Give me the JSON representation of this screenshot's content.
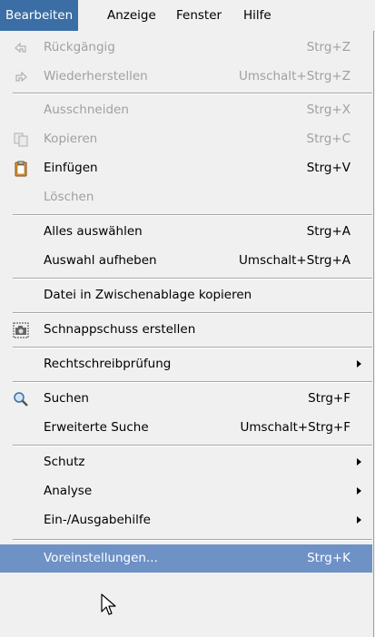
{
  "menubar": {
    "items": [
      "Bearbeiten",
      "Anzeige",
      "Fenster",
      "Hilfe"
    ],
    "active_index": 0
  },
  "menu": {
    "items": [
      {
        "label": "Rückgängig",
        "shortcut": "Strg+Z",
        "enabled": false,
        "icon": "undo-icon"
      },
      {
        "label": "Wiederherstellen",
        "shortcut": "Umschalt+Strg+Z",
        "enabled": false,
        "icon": "redo-icon"
      },
      {
        "label": "Ausschneiden",
        "shortcut": "Strg+X",
        "enabled": false
      },
      {
        "label": "Kopieren",
        "shortcut": "Strg+C",
        "enabled": false,
        "icon": "copy-icon"
      },
      {
        "label": "Einfügen",
        "shortcut": "Strg+V",
        "enabled": true,
        "icon": "paste-icon"
      },
      {
        "label": "Löschen",
        "shortcut": "",
        "enabled": false
      },
      {
        "label": "Alles auswählen",
        "shortcut": "Strg+A",
        "enabled": true
      },
      {
        "label": "Auswahl aufheben",
        "shortcut": "Umschalt+Strg+A",
        "enabled": true
      },
      {
        "label": "Datei in Zwischenablage kopieren",
        "shortcut": "",
        "enabled": true
      },
      {
        "label": "Schnappschuss erstellen",
        "shortcut": "",
        "enabled": true,
        "icon": "camera-icon"
      },
      {
        "label": "Rechtschreibprüfung",
        "shortcut": "",
        "enabled": true,
        "submenu": true
      },
      {
        "label": "Suchen",
        "shortcut": "Strg+F",
        "enabled": true,
        "icon": "search-icon"
      },
      {
        "label": "Erweiterte Suche",
        "shortcut": "Umschalt+Strg+F",
        "enabled": true
      },
      {
        "label": "Schutz",
        "shortcut": "",
        "enabled": true,
        "submenu": true
      },
      {
        "label": "Analyse",
        "shortcut": "",
        "enabled": true,
        "submenu": true
      },
      {
        "label": "Ein-/Ausgabehilfe",
        "shortcut": "",
        "enabled": true,
        "submenu": true
      },
      {
        "label": "Voreinstellungen...",
        "shortcut": "Strg+K",
        "enabled": true,
        "highlighted": true
      }
    ]
  },
  "colors": {
    "menubar_active": "#3a6ea5",
    "highlight": "#6e91c6",
    "disabled_text": "#a0a0a0"
  }
}
